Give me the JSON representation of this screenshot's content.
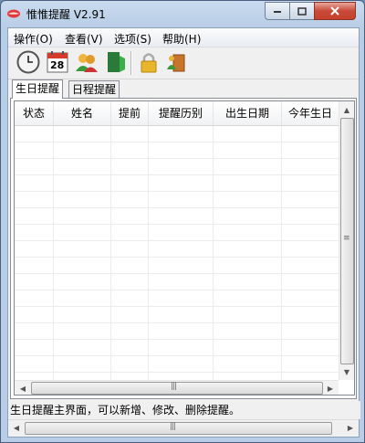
{
  "window": {
    "title": "惟惟提醒 V2.91",
    "icon": "lips-icon"
  },
  "menu": [
    {
      "label": "操作(O)"
    },
    {
      "label": "查看(V)"
    },
    {
      "label": "选项(S)"
    },
    {
      "label": "帮助(H)"
    }
  ],
  "toolbar": {
    "calendar_day": "28",
    "buttons": [
      "clock-icon",
      "calendar-icon",
      "users-icon",
      "exit-door-icon",
      "lock-icon",
      "guardian-icon"
    ]
  },
  "tabs": [
    {
      "label": "生日提醒",
      "active": true
    },
    {
      "label": "日程提醒",
      "active": false
    }
  ],
  "table": {
    "columns": [
      "状态",
      "姓名",
      "提前",
      "提醒历别",
      "出生日期",
      "今年生日"
    ],
    "rows": []
  },
  "status": {
    "text": "生日提醒主界面，可以新增、修改、删除提醒。"
  },
  "colors": {
    "title_bar": "#c9dbef",
    "close_button": "#c84a38"
  }
}
